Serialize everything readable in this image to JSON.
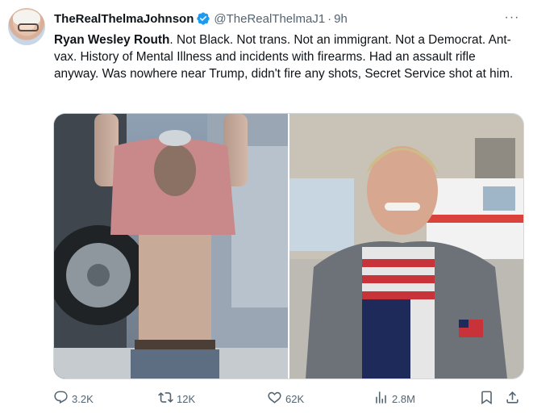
{
  "tweet": {
    "display_name": "TheRealThelmaJohnson",
    "handle": "@TheRealThelmaJ1",
    "separator": "·",
    "time": "9h",
    "more_label": "···",
    "text_bold": "Ryan Wesley Routh",
    "text_rest": ".  Not Black.  Not trans. Not an immigrant.  Not a Democrat.  Ant-vax.  History of Mental Illness and incidents with firearms. Had an assault rifle anyway.  Was nowhere near Trump, didn't fire any shots, Secret Service shot at him."
  },
  "colors": {
    "verified": "#1d9bf0",
    "secondary_text": "#536471",
    "primary_text": "#0f1419",
    "border": "#cfd9de"
  },
  "actions": {
    "replies": "3.2K",
    "reposts": "12K",
    "likes": "62K",
    "views": "2.8M"
  },
  "icons": [
    "reply-icon",
    "repost-icon",
    "like-icon",
    "views-icon",
    "bookmark-icon",
    "share-icon",
    "verified-badge-icon"
  ]
}
